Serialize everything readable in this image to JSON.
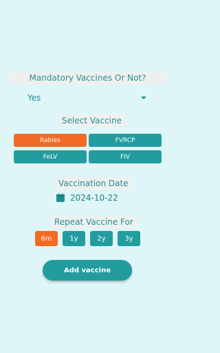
{
  "mandatory": {
    "label": "Mandatory Vaccines Or Not?",
    "value": "Yes"
  },
  "vaccine": {
    "label": "Select Vaccine",
    "options": [
      "Rabies",
      "FVRCP",
      "FeLV",
      "FIV"
    ],
    "selected": "Rabies"
  },
  "date": {
    "label": "Vaccination Date",
    "value": "2024-10-22",
    "icon": "calendar-icon"
  },
  "repeat": {
    "label": "Repeat Vaccine For",
    "options": [
      "6m",
      "1y",
      "2y",
      "3y"
    ],
    "selected": "6m"
  },
  "actions": {
    "add_label": "Add vaccine"
  },
  "colors": {
    "background": "#def6f8",
    "primary": "#239c9f",
    "accent": "#f26a24"
  }
}
